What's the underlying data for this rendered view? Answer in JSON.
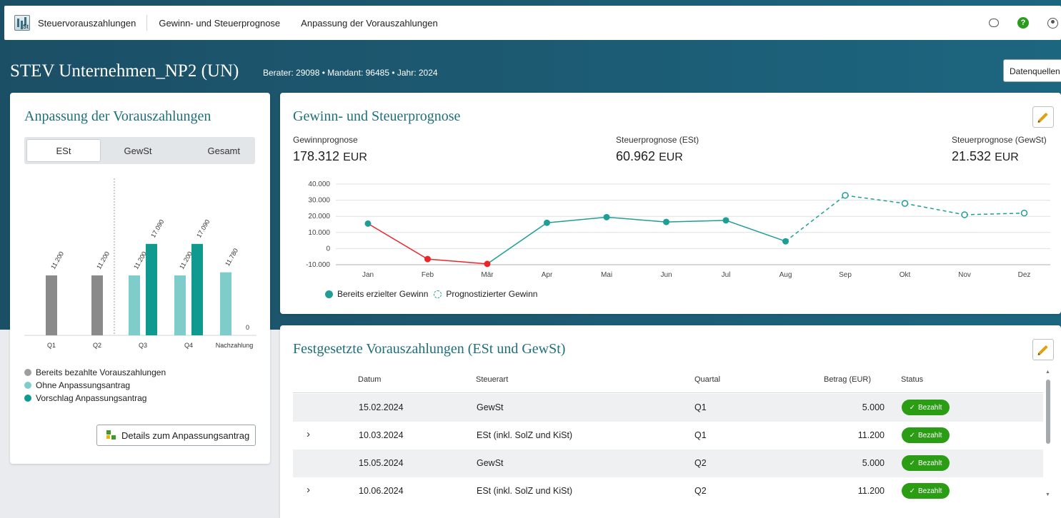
{
  "nav": {
    "links": [
      "Steuervorauszahlungen",
      "Gewinn- und Steuerprognose",
      "Anpassung der Vorauszahlungen"
    ],
    "help_glyph": "?",
    "icons": [
      "app-logo-icon",
      "feedback-icon",
      "help-icon",
      "user-icon"
    ]
  },
  "header": {
    "title": "STEV Unternehmen_NP2 (UN)",
    "meta": "Berater: 29098 • Mandant: 96485 • Jahr: 2024",
    "datasource_label": "Datenquellen"
  },
  "adjustment": {
    "title": "Anpassung der Vorauszahlungen",
    "tabs": [
      "ESt",
      "GewSt",
      "Gesamt"
    ],
    "active_tab": "ESt",
    "chart": {
      "type": "bar",
      "categories": [
        "Q1",
        "Q2",
        "Q3",
        "Q4",
        "Nachzahlung"
      ],
      "series": [
        {
          "name": "Bereits bezahlte Vorauszahlungen",
          "color": "#8a8a8a",
          "values": [
            11200,
            11200,
            null,
            null,
            null
          ]
        },
        {
          "name": "Ohne Anpassungsantrag",
          "color": "#7fcdcb",
          "values": [
            null,
            null,
            11200,
            11200,
            11780
          ]
        },
        {
          "name": "Vorschlag Anpassungsantrag",
          "color": "#0e9a8e",
          "values": [
            null,
            null,
            17090,
            17090,
            0
          ]
        }
      ],
      "value_labels": [
        "11.200",
        "11.200",
        "11.200",
        "17.090",
        "11.200",
        "17.090",
        "11.780",
        "0"
      ]
    },
    "legend": [
      "Bereits bezahlte Vorauszahlungen",
      "Ohne Anpassungsantrag",
      "Vorschlag Anpassungsantrag"
    ],
    "details_button": "Details zum Anpassungsantrag"
  },
  "forecast": {
    "title": "Gewinn- und Steuerprognose",
    "kpis": [
      {
        "label": "Gewinnprognose",
        "value": "178.312",
        "unit": "EUR"
      },
      {
        "label": "Steuerprognose (ESt)",
        "value": "60.962",
        "unit": "EUR"
      },
      {
        "label": "Steuerprognose (GewSt)",
        "value": "21.532",
        "unit": "EUR"
      }
    ],
    "legend": [
      "Bereits erzielter Gewinn",
      "Prognostizierter Gewinn"
    ]
  },
  "chart_data": {
    "type": "line",
    "x": [
      "Jan",
      "Feb",
      "Mär",
      "Apr",
      "Mai",
      "Jun",
      "Jul",
      "Aug",
      "Sep",
      "Okt",
      "Nov",
      "Dez"
    ],
    "y_ticks": [
      "40.000",
      "30.000",
      "20.000",
      "10.000",
      "0",
      "-10.000"
    ],
    "ylim": [
      -10000,
      40000
    ],
    "series": [
      {
        "name": "Bereits erzielter Gewinn",
        "color": "#1f9e95",
        "negative_color": "#e8262b",
        "values": [
          15500,
          -6500,
          -9500,
          16000,
          19500,
          16500,
          17500,
          4500,
          null,
          null,
          null,
          null
        ]
      },
      {
        "name": "Prognostizierter Gewinn",
        "color": "#1f9e95",
        "style": "dashed",
        "values": [
          null,
          null,
          null,
          null,
          null,
          null,
          null,
          4500,
          33000,
          28000,
          21000,
          22000
        ]
      }
    ],
    "grid": true,
    "legend_position": "bottom-left"
  },
  "payments": {
    "title": "Festgesetzte Vorauszahlungen (ESt und GewSt)",
    "columns": [
      "Datum",
      "Steuerart",
      "Quartal",
      "Betrag (EUR)",
      "Status"
    ],
    "rows": [
      {
        "expandable": false,
        "datum": "15.02.2024",
        "steuerart": "GewSt",
        "quartal": "Q1",
        "betrag": "5.000",
        "status": "Bezahlt"
      },
      {
        "expandable": true,
        "datum": "10.03.2024",
        "steuerart": "ESt (inkl. SolZ und KiSt)",
        "quartal": "Q1",
        "betrag": "11.200",
        "status": "Bezahlt"
      },
      {
        "expandable": false,
        "datum": "15.05.2024",
        "steuerart": "GewSt",
        "quartal": "Q2",
        "betrag": "5.000",
        "status": "Bezahlt"
      },
      {
        "expandable": true,
        "datum": "10.06.2024",
        "steuerart": "ESt (inkl. SolZ und KiSt)",
        "quartal": "Q2",
        "betrag": "11.200",
        "status": "Bezahlt"
      }
    ],
    "expand_glyph": "›",
    "status_check": "✓",
    "status_color": "#2a9d14"
  }
}
